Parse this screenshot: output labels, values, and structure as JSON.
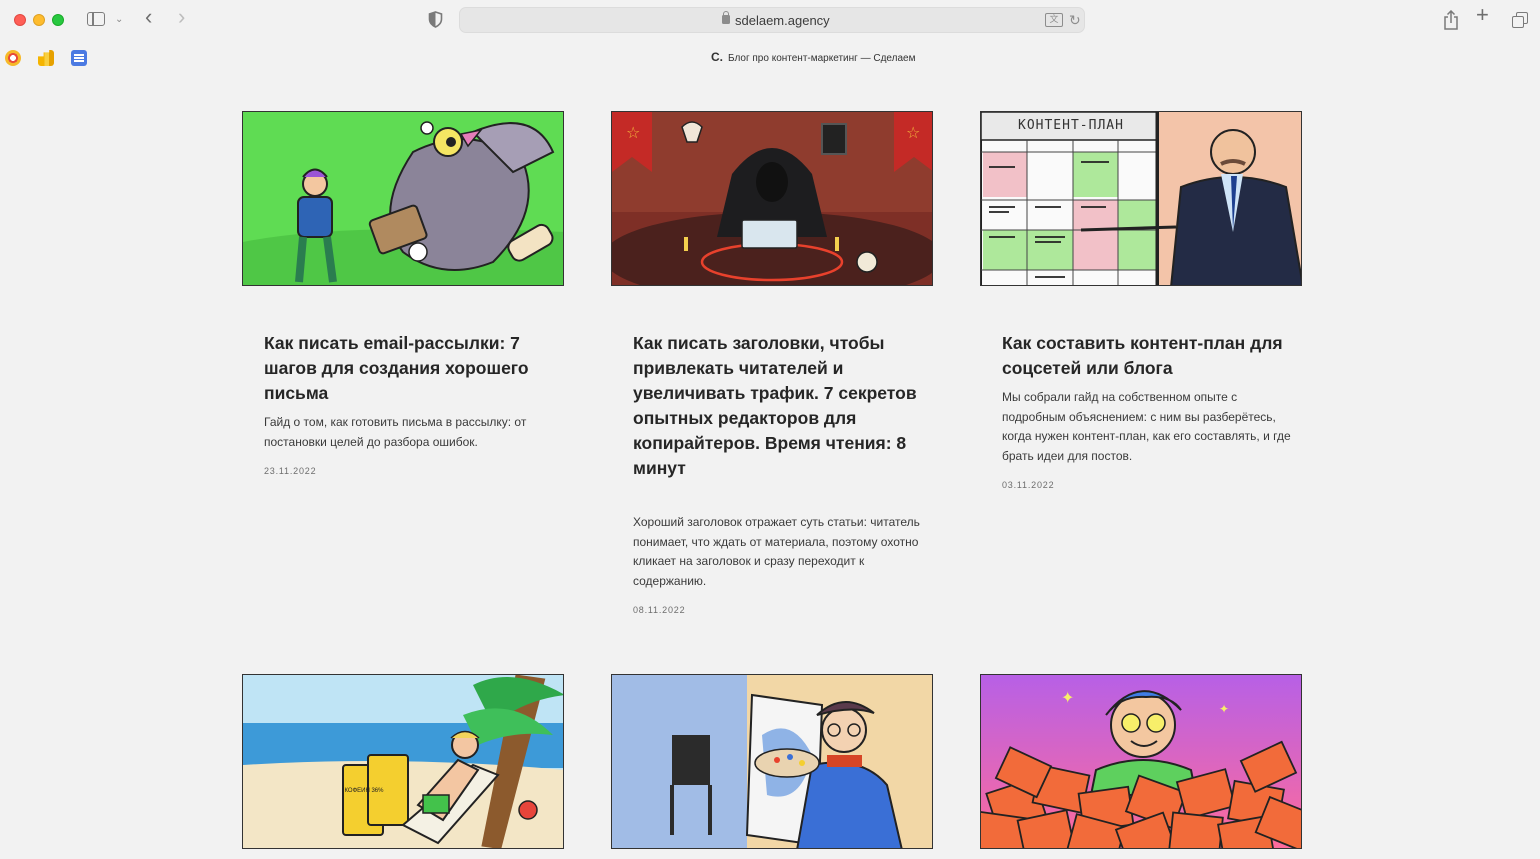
{
  "browser": {
    "url": "sdelaem.agency",
    "page_heading_logo": "С.",
    "page_heading": "Блог про контент-маркетинг — Сделаем"
  },
  "cards": [
    {
      "title": "Как писать email-рассылки: 7 шагов для создания хорошего письма",
      "description": "Гайд о том, как готовить письма в рассылку: от постановки целей до разбора ошибок.",
      "date": "23.11.2022",
      "image": "pigeon-courier-illustration",
      "bg": "#5fdc53"
    },
    {
      "title": "Как писать заголовки, чтобы привлекать читателей и увеличивать трафик. 7 секретов опытных редакторов для копирайтеров. Время чтения: 8 минут",
      "description": "Хороший заголовок отражает суть статьи: читатель понимает, что ждать от материала, поэтому охотно кликает на заголовок и сразу переходит к содержанию.",
      "date": "08.11.2022",
      "image": "hooded-ritual-illustration",
      "bg": "#8a3a2c"
    },
    {
      "title": "Как составить контент-план для соцсетей или блога",
      "description": "Мы собрали гайд на собственном опыте с подробным объяснением: с ним вы разберётесь, когда нужен контент-план, как его составлять, и где брать идеи для постов.",
      "date": "03.11.2022",
      "image": "content-plan-presenter-illustration",
      "image_caption": "КОНТЕНТ-ПЛАН",
      "bg": "#f3c4a9"
    },
    {
      "title": "",
      "image": "beach-coffee-illustration",
      "image_caption": "КОФЕИН 36%",
      "bg": "#bfe4f5"
    },
    {
      "title": "",
      "image": "artist-easel-illustration",
      "bg": "#f2d7a6"
    },
    {
      "title": "",
      "image": "pile-of-books-illustration",
      "bg": "#e86cae"
    }
  ]
}
